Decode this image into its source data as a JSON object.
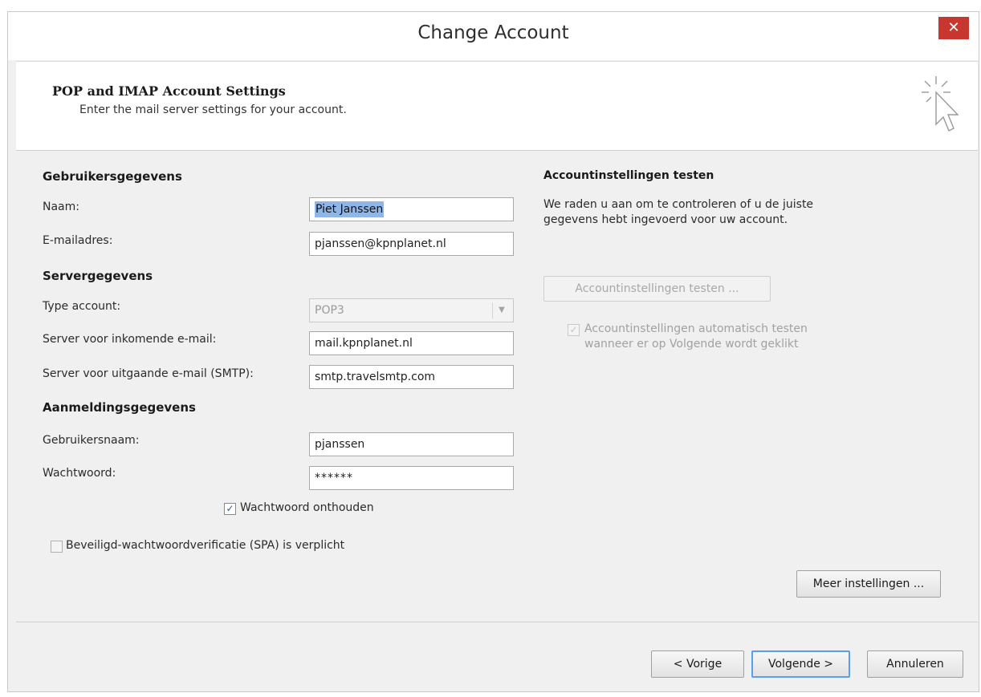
{
  "window": {
    "title": "Change Account",
    "close_glyph": "✕"
  },
  "header": {
    "title": "POP and IMAP Account Settings",
    "subtitle": "Enter the mail server settings for your account.",
    "icon": "wizard-cursor-icon"
  },
  "user_section": {
    "heading": "Gebruikersgegevens",
    "name_label": "Naam:",
    "name_value": "Piet Janssen",
    "email_label": "E-mailadres:",
    "email_value": "pjanssen@kpnplanet.nl"
  },
  "server_section": {
    "heading": "Servergegevens",
    "type_label": "Type account:",
    "type_value": "POP3",
    "incoming_label": "Server voor inkomende e-mail:",
    "incoming_value": "mail.kpnplanet.nl",
    "outgoing_label": "Server voor uitgaande e-mail (SMTP):",
    "outgoing_value": "smtp.travelsmtp.com"
  },
  "login_section": {
    "heading": "Aanmeldingsgegevens",
    "username_label": "Gebruikersnaam:",
    "username_value": "pjanssen",
    "password_label": "Wachtwoord:",
    "password_value": "******",
    "remember_label": "Wachtwoord onthouden",
    "remember_checked": true,
    "spa_label": "Beveiligd-wachtwoordverificatie (SPA) is verplicht",
    "spa_checked": false
  },
  "test_section": {
    "heading": "Accountinstellingen testen",
    "desc_line1": "We raden u aan om te controleren of u de juiste",
    "desc_line2": "gegevens hebt ingevoerd voor uw account.",
    "test_button": "Accountinstellingen testen ...",
    "auto_test_line1": "Accountinstellingen automatisch testen",
    "auto_test_line2": "wanneer er op Volgende wordt geklikt",
    "auto_test_checked": true
  },
  "more_settings_button": "Meer instellingen ...",
  "footer": {
    "back_button": "< Vorige",
    "next_button": "Volgende >",
    "cancel_button": "Annuleren"
  },
  "colors": {
    "close_button": "#c7372f",
    "selection": "#8fb6e9",
    "primary_border": "#58a0e8",
    "dialog_bg": "#f0f0f0"
  }
}
